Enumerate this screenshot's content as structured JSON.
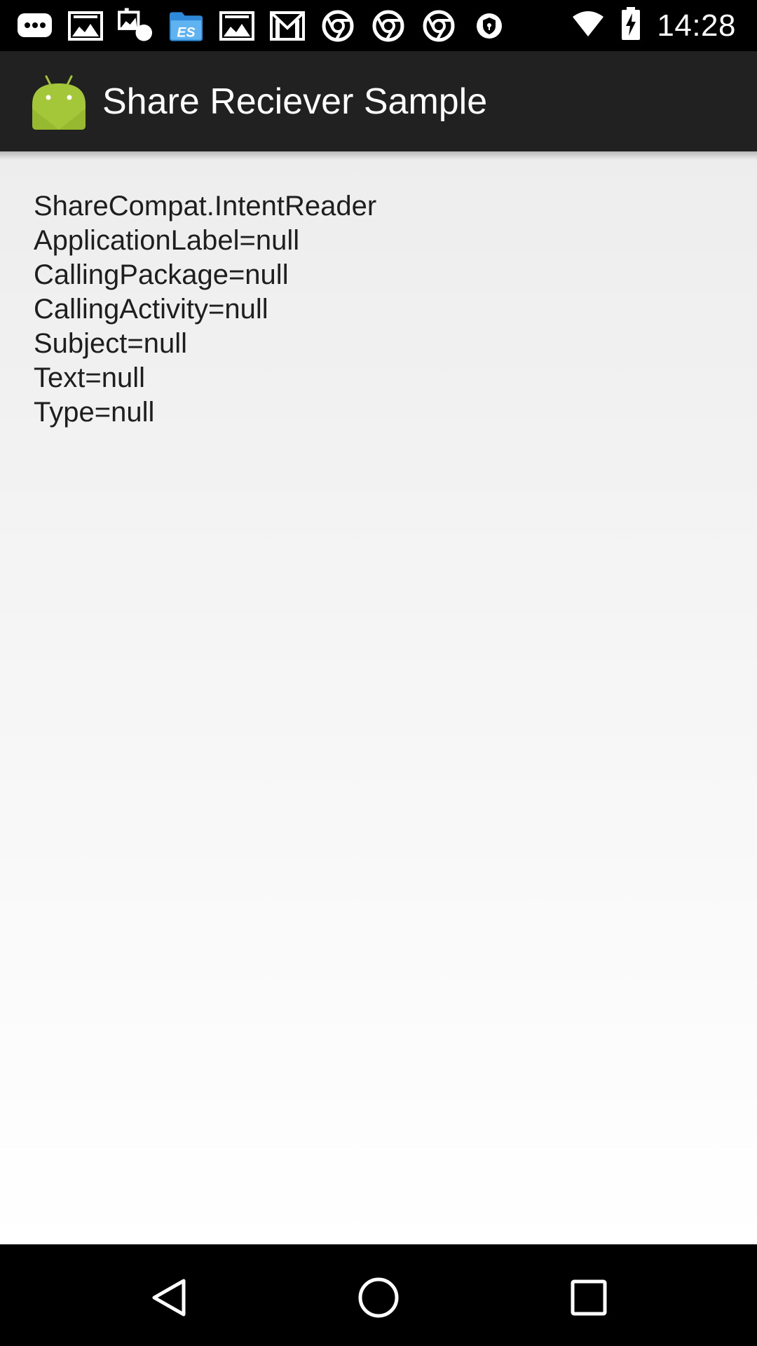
{
  "status_bar": {
    "time": "14:28",
    "notification_icons": [
      "chat-icon",
      "image-icon",
      "image-settings-icon",
      "es-file-explorer-icon",
      "image-icon",
      "gmail-icon",
      "chrome-icon",
      "chrome-icon",
      "chrome-icon",
      "vpn-shield-icon"
    ],
    "system_icons": [
      "wifi-icon",
      "battery-icon"
    ]
  },
  "action_bar": {
    "title": "Share Reciever Sample",
    "app_icon": "android-icon",
    "background": "#212121"
  },
  "content": {
    "lines": [
      "ShareCompat.IntentReader",
      "ApplicationLabel=null",
      "CallingPackage=null",
      "CallingActivity=null",
      "Subject=null",
      "Text=null",
      "Type=null"
    ]
  },
  "nav_bar": {
    "buttons": [
      "back-icon",
      "home-icon",
      "recents-icon"
    ]
  }
}
